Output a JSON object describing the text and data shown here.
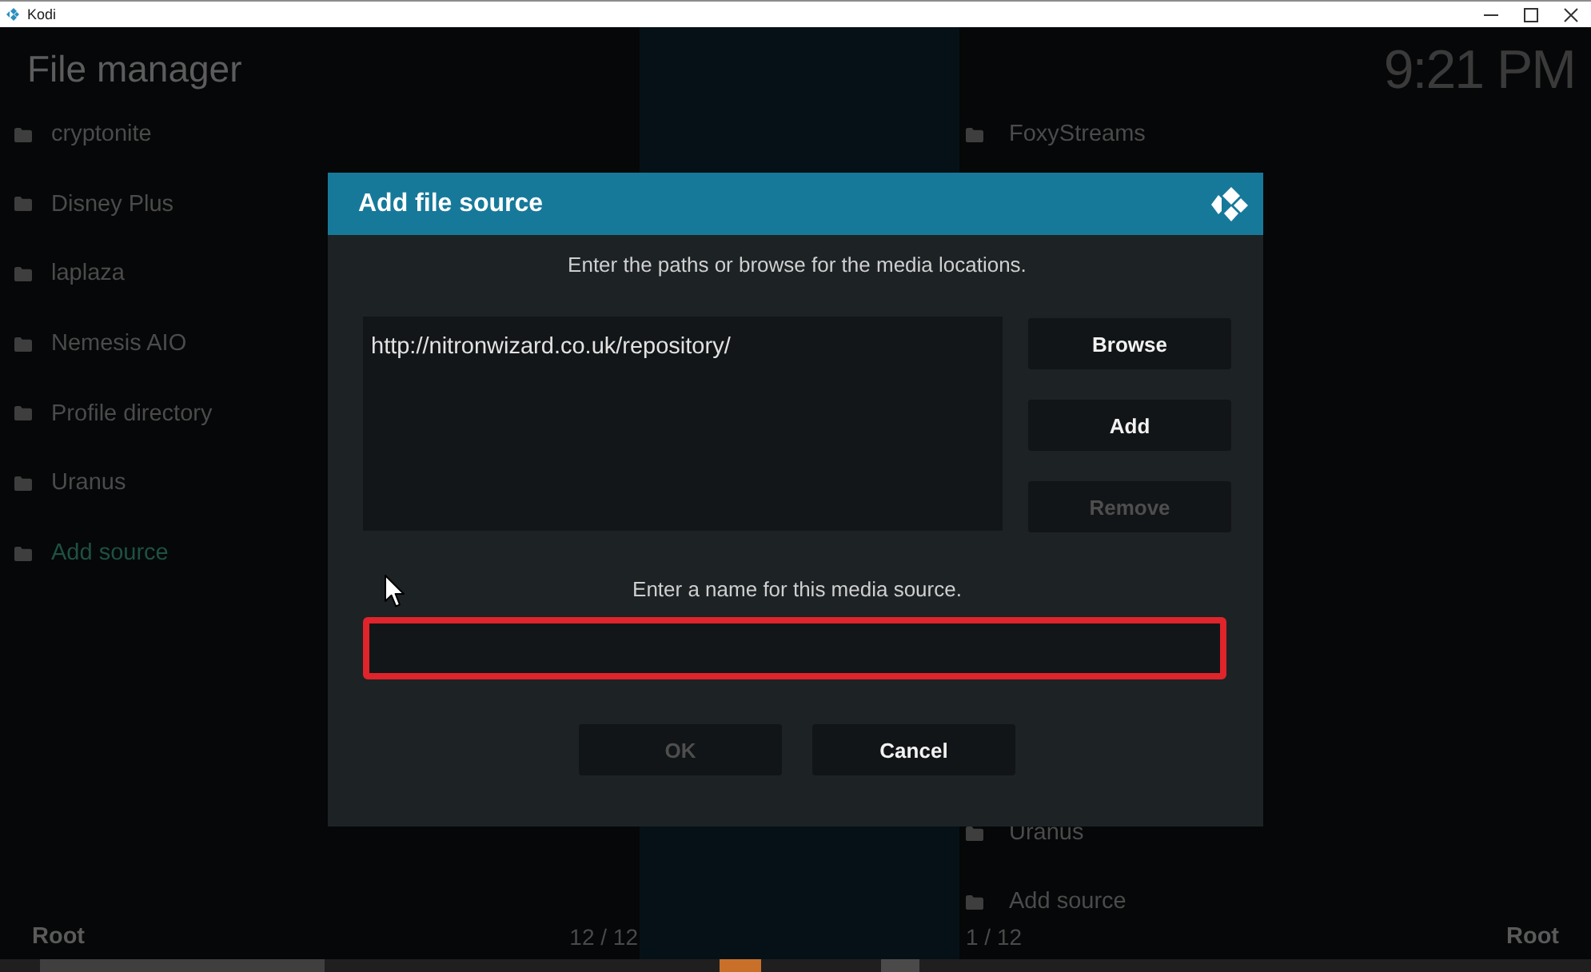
{
  "window": {
    "title": "Kodi"
  },
  "header": {
    "title": "File manager",
    "clock": "9:21 PM"
  },
  "left_panel": {
    "items": [
      {
        "label": "cryptonite",
        "selected": false
      },
      {
        "label": "Disney Plus",
        "selected": false
      },
      {
        "label": "laplaza",
        "selected": false
      },
      {
        "label": "Nemesis AIO",
        "selected": false
      },
      {
        "label": "Profile directory",
        "selected": false
      },
      {
        "label": "Uranus",
        "selected": false
      },
      {
        "label": "Add source",
        "selected": true
      }
    ],
    "footer": {
      "path": "Root",
      "count": "12 / 12"
    }
  },
  "right_panel": {
    "items": [
      {
        "label": "FoxyStreams",
        "selected": false
      },
      {
        "label": "Uranus",
        "selected": false
      },
      {
        "label": "Add source",
        "selected": false
      }
    ],
    "footer": {
      "count": "1 / 12",
      "path": "Root"
    }
  },
  "dialog": {
    "title": "Add file source",
    "paths_prompt": "Enter the paths or browse for the media locations.",
    "paths": [
      "http://nitronwizard.co.uk/repository/"
    ],
    "side_buttons": [
      {
        "label": "Browse",
        "disabled": false
      },
      {
        "label": "Add",
        "disabled": false
      },
      {
        "label": "Remove",
        "disabled": true
      }
    ],
    "name_prompt": "Enter a name for this media source.",
    "name_field": {
      "highlighted": true
    },
    "buttons": [
      {
        "label": "OK",
        "disabled": true
      },
      {
        "label": "Cancel",
        "disabled": false
      }
    ]
  }
}
